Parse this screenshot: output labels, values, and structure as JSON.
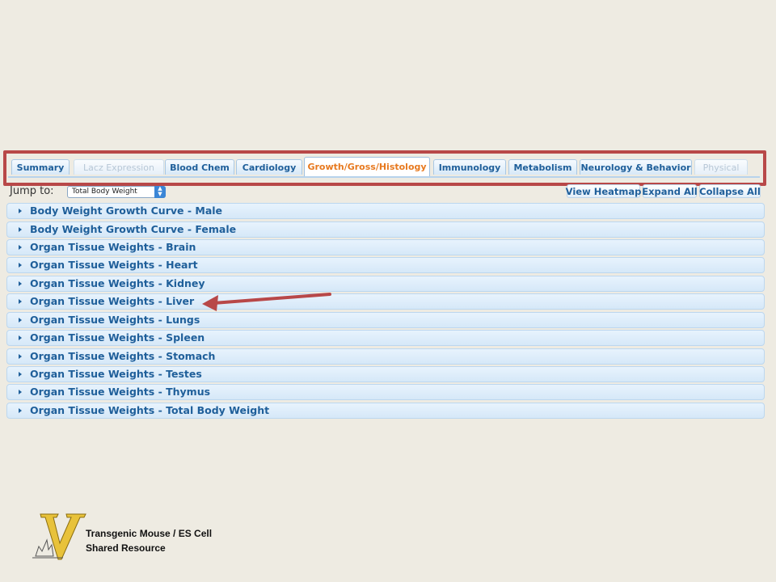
{
  "tabs": [
    {
      "label": "Summary",
      "state": "normal"
    },
    {
      "label": "Lacz Expression",
      "state": "disabled"
    },
    {
      "label": "Blood Chem",
      "state": "normal"
    },
    {
      "label": "Cardiology",
      "state": "normal"
    },
    {
      "label": "Growth/Gross/Histology",
      "state": "active"
    },
    {
      "label": "Immunology",
      "state": "normal"
    },
    {
      "label": "Metabolism",
      "state": "normal"
    },
    {
      "label": "Neurology & Behavior",
      "state": "normal"
    },
    {
      "label": "Physical",
      "state": "disabled"
    }
  ],
  "toolbar": {
    "jump_label": "Jump to:",
    "jump_value": "Total Body Weight",
    "view_heatmap": "View Heatmap",
    "expand_all": "Expand All",
    "collapse_all": "Collapse All"
  },
  "sections": [
    "Body Weight Growth Curve - Male",
    "Body Weight Growth Curve - Female",
    "Organ Tissue Weights - Brain",
    "Organ Tissue Weights - Heart",
    "Organ Tissue Weights - Kidney",
    "Organ Tissue Weights - Liver",
    "Organ Tissue Weights - Lungs",
    "Organ Tissue Weights - Spleen",
    "Organ Tissue Weights - Stomach",
    "Organ Tissue Weights - Testes",
    "Organ Tissue Weights - Thymus",
    "Organ Tissue Weights - Total Body Weight"
  ],
  "logo": {
    "letter": "V",
    "line1": "Transgenic Mouse / ES Cell",
    "line2": "Shared Resource"
  },
  "colors": {
    "background": "#eeebe2",
    "link_blue": "#1f5f9a",
    "active_tab": "#e7791f",
    "highlight_red": "#b84848",
    "logo_gold": "#e8c23a"
  }
}
